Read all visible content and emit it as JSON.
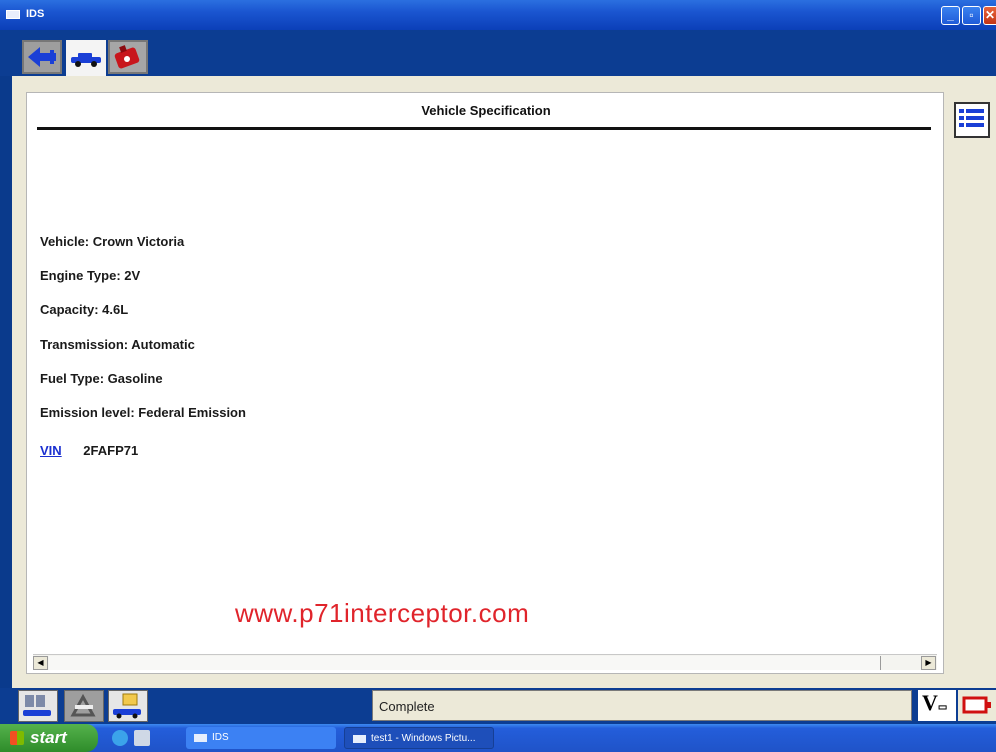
{
  "window": {
    "title": "IDS",
    "icon": "window-icon",
    "controls": [
      "minimize-icon",
      "maximize-icon",
      "close-icon"
    ]
  },
  "toolbar": {
    "tools": [
      {
        "name": "back-arrow-icon",
        "color": "#1a3fd6"
      },
      {
        "name": "vehicle-icon",
        "color": "#1a3fd6",
        "selected": true
      },
      {
        "name": "engine-icon",
        "color": "#c8161c"
      }
    ]
  },
  "panel": {
    "title": "Vehicle Specification",
    "specs": [
      {
        "label": "Vehicle:",
        "value": "Crown Victoria"
      },
      {
        "label": "Engine Type:",
        "value": "2V"
      },
      {
        "label": "Capacity:",
        "value": "4.6L"
      },
      {
        "label": "Transmission:",
        "value": "Automatic"
      },
      {
        "label": "Fuel Type:",
        "value": "Gasoline"
      },
      {
        "label": "Emission level:",
        "value": "Federal Emission"
      }
    ],
    "vin": {
      "link": "VIN",
      "value": "2FAFP71"
    },
    "watermark": "www.p71interceptor.com"
  },
  "side": {
    "list_icon": "list-icon"
  },
  "statusbar": {
    "icons": [
      "vehicle-session-icon",
      "toolbox-icon",
      "vehicle-folder-icon"
    ],
    "status": "Complete",
    "voltage_label": "V",
    "battery_icon": "battery-icon"
  },
  "taskbar": {
    "start": "start",
    "tasks": [
      "IDS",
      "test1 - Windows Pictu..."
    ]
  },
  "colors": {
    "window_blue": "#0c3d92",
    "accent_red": "#e0242b",
    "link_blue": "#1a2fd0"
  }
}
